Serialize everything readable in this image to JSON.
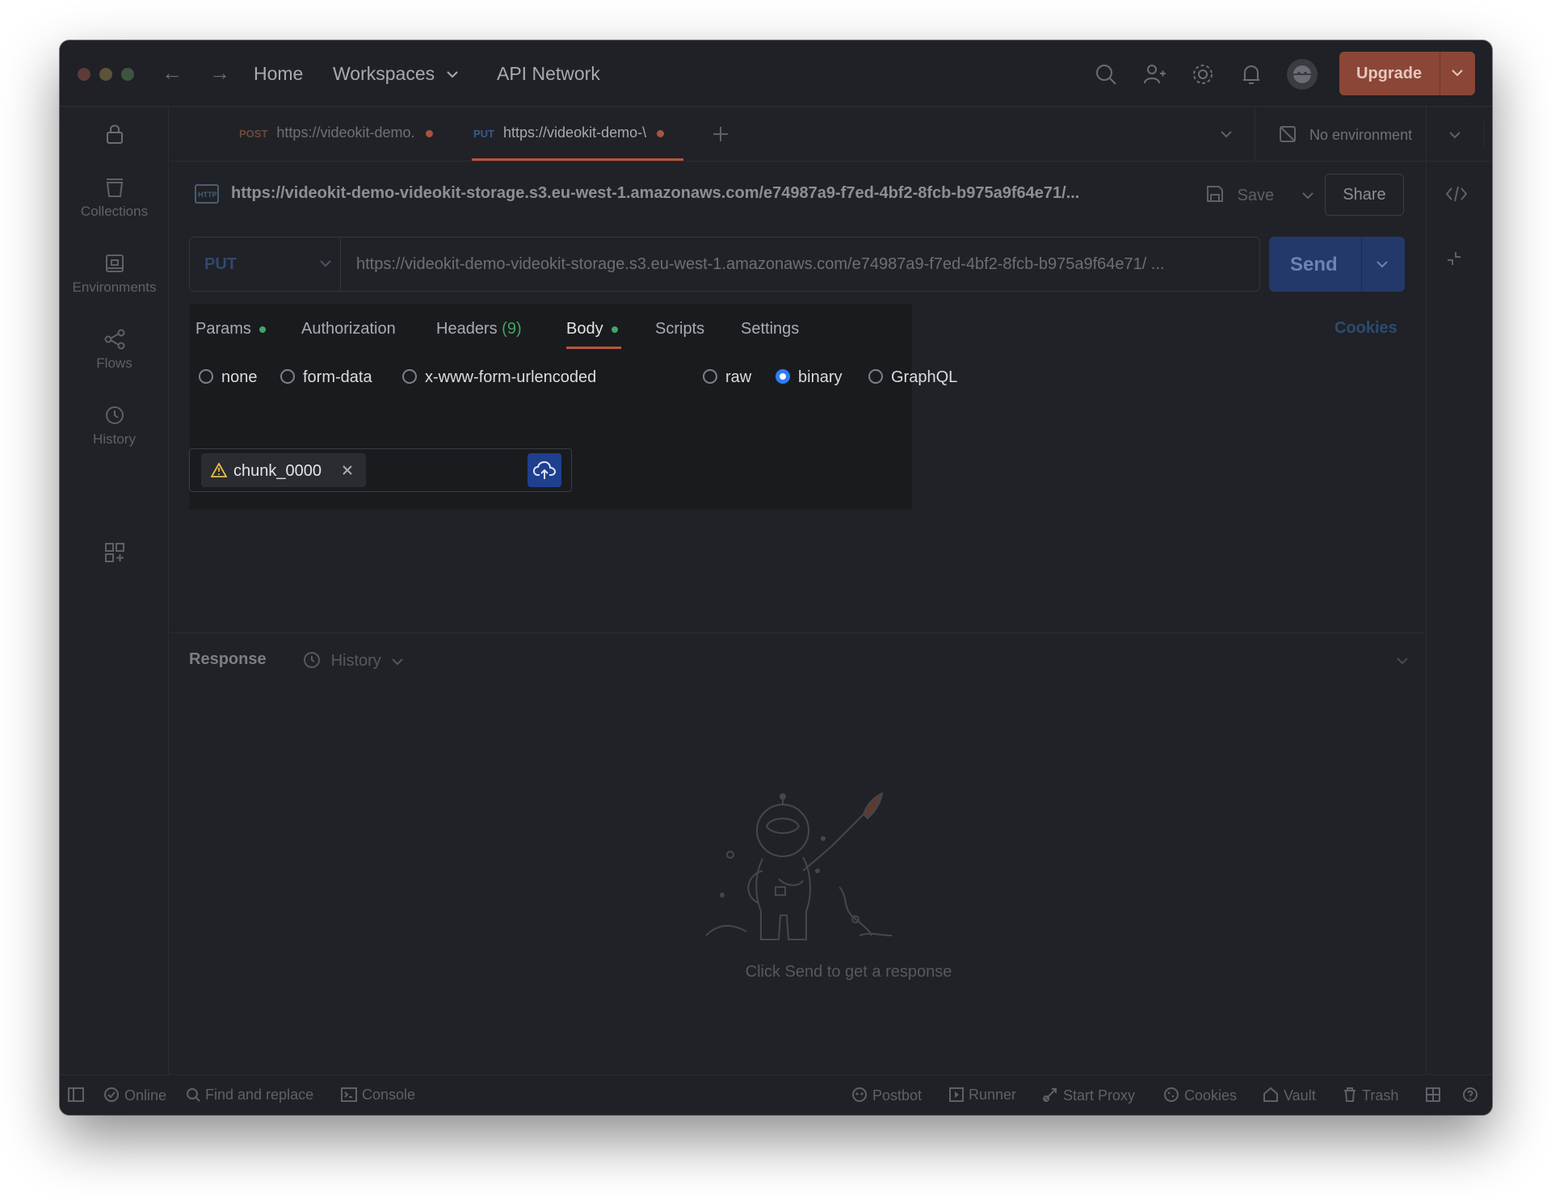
{
  "nav": {
    "home": "Home",
    "workspaces": "Workspaces",
    "api_network": "API Network",
    "upgrade": "Upgrade"
  },
  "sidebar": {
    "items": [
      {
        "label": "Collections",
        "icon": "collections-icon"
      },
      {
        "label": "Environments",
        "icon": "environments-icon"
      },
      {
        "label": "Flows",
        "icon": "flows-icon"
      },
      {
        "label": "History",
        "icon": "history-icon"
      }
    ]
  },
  "tabs": [
    {
      "method": "POST",
      "label": "https://videokit-demo."
    },
    {
      "method": "PUT",
      "label": "https://videokit-demo-\\"
    }
  ],
  "environment": "No environment",
  "request": {
    "title": "https://videokit-demo-videokit-storage.s3.eu-west-1.amazonaws.com/e74987a9-f7ed-4bf2-8fcb-b975a9f64e71/...",
    "method": "PUT",
    "url": "https://videokit-demo-videokit-storage.s3.eu-west-1.amazonaws.com/e74987a9-f7ed-4bf2-8fcb-b975a9f64e71/ ...",
    "save": "Save",
    "share": "Share",
    "send": "Send",
    "cookies": "Cookies"
  },
  "request_tabs": {
    "params": "Params",
    "authorization": "Authorization",
    "headers": "Headers",
    "headers_count": "(9)",
    "body": "Body",
    "scripts": "Scripts",
    "settings": "Settings"
  },
  "body_types": {
    "none": "none",
    "form_data": "form-data",
    "urlencoded": "x-www-form-urlencoded",
    "raw": "raw",
    "binary": "binary",
    "graphql": "GraphQL",
    "selected": "binary"
  },
  "file": {
    "name": "chunk_0000"
  },
  "response": {
    "title": "Response",
    "history": "History",
    "empty": "Click Send to get a response"
  },
  "statusbar": {
    "online": "Online",
    "find_replace": "Find and replace",
    "console": "Console",
    "postbot": "Postbot",
    "runner": "Runner",
    "start_proxy": "Start Proxy",
    "cookies": "Cookies",
    "vault": "Vault",
    "trash": "Trash"
  },
  "colors": {
    "accent_orange": "#b8553d",
    "send_blue": "#22396a",
    "radio_blue": "#2e7cf6",
    "status_green": "#3fa662"
  }
}
